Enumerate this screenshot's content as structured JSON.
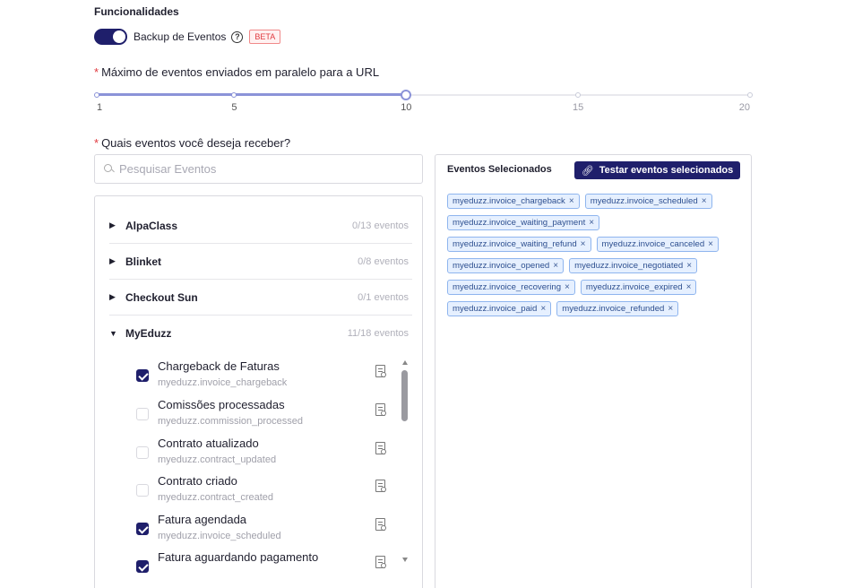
{
  "section_title": "Funcionalidades",
  "backup": {
    "label": "Backup de Eventos",
    "help": "?",
    "badge": "BETA",
    "enabled": true
  },
  "max_events": {
    "label": "Máximo de eventos enviados em paralelo para a URL",
    "required_mark": "*",
    "marks": [
      "1",
      "5",
      "10",
      "15",
      "20"
    ],
    "value": 10,
    "min": 1,
    "max": 20
  },
  "events_question": {
    "label": "Quais eventos você deseja receber?",
    "required_mark": "*"
  },
  "search": {
    "placeholder": "Pesquisar Eventos",
    "value": ""
  },
  "groups": [
    {
      "name": "AlpaClass",
      "count": "0/13 eventos",
      "expanded": false
    },
    {
      "name": "Blinket",
      "count": "0/8 eventos",
      "expanded": false
    },
    {
      "name": "Checkout Sun",
      "count": "0/1 eventos",
      "expanded": false
    },
    {
      "name": "MyEduzz",
      "count": "11/18 eventos",
      "expanded": true
    }
  ],
  "events": [
    {
      "title": "Chargeback de Faturas",
      "code": "myeduzz.invoice_chargeback",
      "checked": true
    },
    {
      "title": "Comissões processadas",
      "code": "myeduzz.commission_processed",
      "checked": false
    },
    {
      "title": "Contrato atualizado",
      "code": "myeduzz.contract_updated",
      "checked": false
    },
    {
      "title": "Contrato criado",
      "code": "myeduzz.contract_created",
      "checked": false
    },
    {
      "title": "Fatura agendada",
      "code": "myeduzz.invoice_scheduled",
      "checked": true
    },
    {
      "title": "Fatura aguardando pagamento",
      "code": "",
      "checked": true
    }
  ],
  "selected": {
    "title": "Eventos Selecionados",
    "test_button": "Testar eventos selecionados",
    "tags": [
      "myeduzz.invoice_chargeback",
      "myeduzz.invoice_scheduled",
      "myeduzz.invoice_waiting_payment",
      "myeduzz.invoice_waiting_refund",
      "myeduzz.invoice_canceled",
      "myeduzz.invoice_opened",
      "myeduzz.invoice_negotiated",
      "myeduzz.invoice_recovering",
      "myeduzz.invoice_expired",
      "myeduzz.invoice_paid",
      "myeduzz.invoice_refunded"
    ],
    "remove_glyph": "×"
  },
  "colors": {
    "primary": "#1f1f6b",
    "accent_slider": "#8b93d8",
    "danger": "#e0393e",
    "tag_bg": "#e6f0ff",
    "tag_border": "#8fb5ee"
  },
  "icons": {
    "search": "search-icon",
    "help": "help-circle-icon",
    "doc": "document-search-icon",
    "link": "link-icon",
    "remove": "close-icon",
    "caret": "caret-icon"
  }
}
